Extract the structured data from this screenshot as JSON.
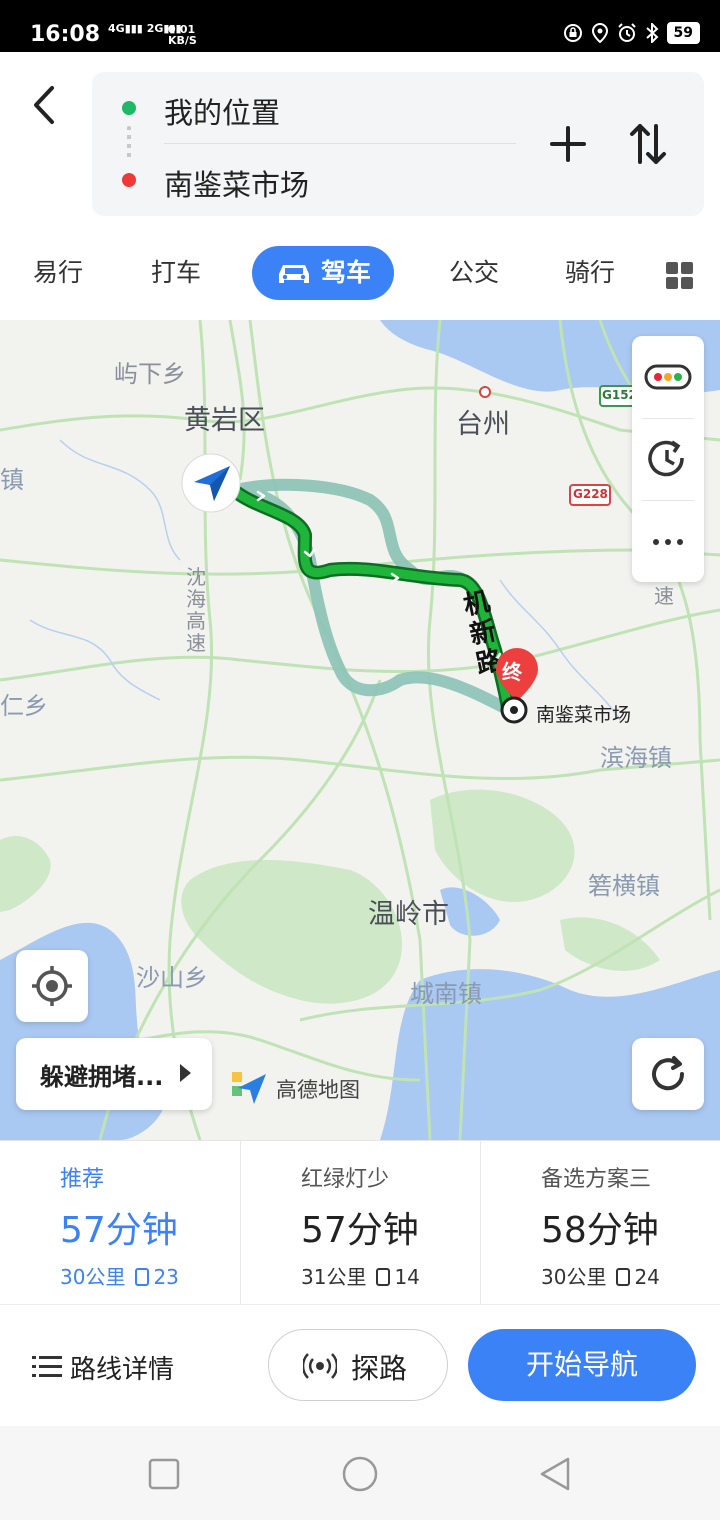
{
  "status_bar": {
    "time": "16:08",
    "network_4g": "4G",
    "network_2g": "2G",
    "speed_value": "0.01",
    "speed_unit": "KB/S",
    "battery": "59"
  },
  "route": {
    "start": "我的位置",
    "destination": "南鉴菜市场"
  },
  "tabs": [
    {
      "label": "易行",
      "active": false
    },
    {
      "label": "打车",
      "active": false
    },
    {
      "label": "驾车",
      "active": true
    },
    {
      "label": "公交",
      "active": false
    },
    {
      "label": "骑行",
      "active": false
    }
  ],
  "map": {
    "labels": {
      "xiaxia": "屿下乡",
      "huangyan": "黄岩区",
      "taizhou": "台州",
      "zhen_left": "镇",
      "shenhai": "沈海高速",
      "renxiang": "仁乡",
      "binhai": "滨海镇",
      "xiaheng": "箬横镇",
      "wenling": "温岭市",
      "shashan": "沙山乡",
      "chengnan": "城南镇",
      "road_g152": "G152",
      "road_g228": "G228",
      "su": "速"
    },
    "road_name": "机新路",
    "dest_marker": "终",
    "dest_label": "南鉴菜市场",
    "avoid_label": "躲避拥堵...",
    "logo_text": "高德地图"
  },
  "options": [
    {
      "name": "推荐",
      "time": "57分钟",
      "distance": "30公里",
      "lights": "23",
      "active": true
    },
    {
      "name": "红绿灯少",
      "time": "57分钟",
      "distance": "31公里",
      "lights": "14",
      "active": false
    },
    {
      "name": "备选方案三",
      "time": "58分钟",
      "distance": "30公里",
      "lights": "24",
      "active": false
    }
  ],
  "actions": {
    "details": "路线详情",
    "probe": "探路",
    "start": "开始导航"
  },
  "colors": {
    "accent": "#3b82f6",
    "route_main": "#1fb53a",
    "route_alt": "#8fc4b8",
    "start_dot": "#1db964",
    "end_dot": "#ef3939"
  }
}
